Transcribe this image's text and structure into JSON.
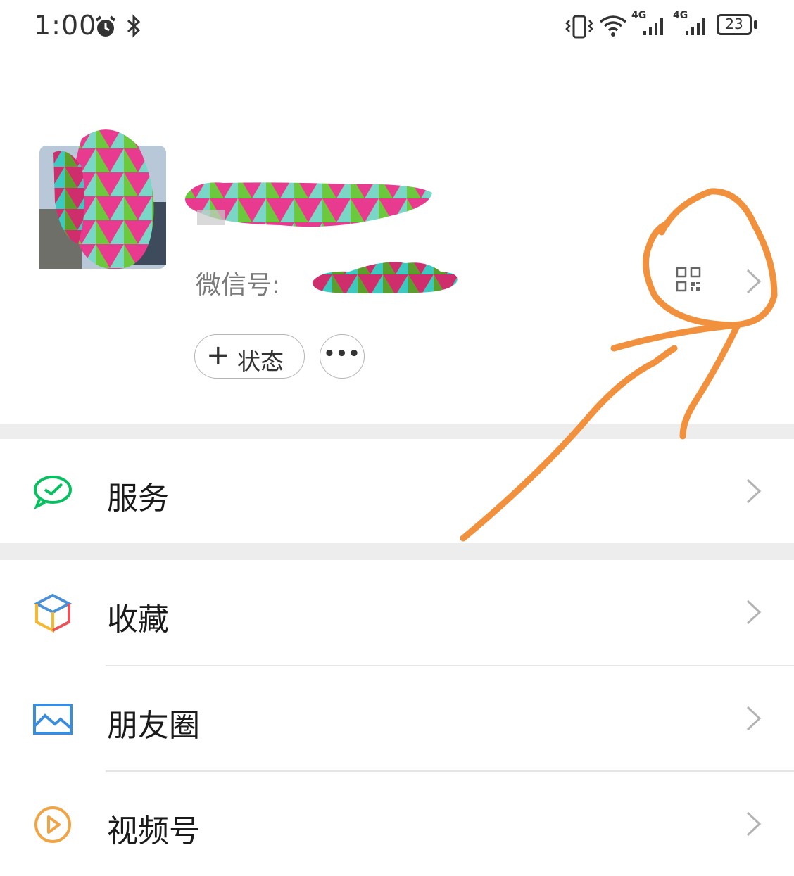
{
  "status_bar": {
    "time": "1:00",
    "icons": [
      "alarm-icon",
      "bluetooth-icon",
      "vibrate-icon",
      "wifi-icon",
      "signal-4g-icon",
      "signal-4g-icon",
      "battery-icon"
    ],
    "network_label_1": "4G",
    "network_label_2": "4G",
    "battery_level": "23"
  },
  "profile": {
    "avatar_icon": "redacted-avatar",
    "wechat_id_label": "微信号:",
    "qr_icon": "qr-code-icon",
    "status_button_plus": "+",
    "status_button_label": "状态",
    "more_button_label": "•••"
  },
  "menu": [
    {
      "label": "服务",
      "icon": "service-icon",
      "color": "#07c160"
    },
    {
      "label": "收藏",
      "icon": "favorites-cube-icon",
      "color": "#4a90d9"
    },
    {
      "label": "朋友圈",
      "icon": "moments-image-icon",
      "color": "#3b8ddb"
    },
    {
      "label": "视频号",
      "icon": "channels-play-icon",
      "color": "#f0a445"
    }
  ],
  "annotation_color": "#f2913d"
}
